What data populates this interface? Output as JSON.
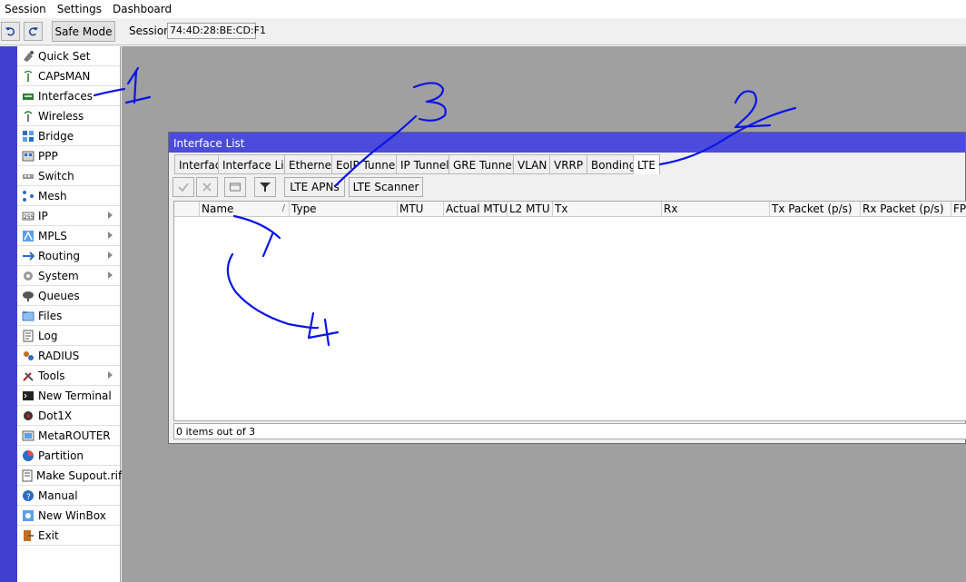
{
  "menu": [
    "Session",
    "Settings",
    "Dashboard"
  ],
  "toolbar": {
    "safe_mode_label": "Safe Mode",
    "session_label": "Session:",
    "session_value": "74:4D:28:BE:CD:F1"
  },
  "sidebar": {
    "items": [
      {
        "label": "Quick Set",
        "icon": "quick-set-icon",
        "submenu": false
      },
      {
        "label": "CAPsMAN",
        "icon": "capsman-icon",
        "submenu": false
      },
      {
        "label": "Interfaces",
        "icon": "interfaces-icon",
        "submenu": false
      },
      {
        "label": "Wireless",
        "icon": "wireless-icon",
        "submenu": false
      },
      {
        "label": "Bridge",
        "icon": "bridge-icon",
        "submenu": false
      },
      {
        "label": "PPP",
        "icon": "ppp-icon",
        "submenu": false
      },
      {
        "label": "Switch",
        "icon": "switch-icon",
        "submenu": false
      },
      {
        "label": "Mesh",
        "icon": "mesh-icon",
        "submenu": false
      },
      {
        "label": "IP",
        "icon": "ip-icon",
        "submenu": true
      },
      {
        "label": "MPLS",
        "icon": "mpls-icon",
        "submenu": true
      },
      {
        "label": "Routing",
        "icon": "routing-icon",
        "submenu": true
      },
      {
        "label": "System",
        "icon": "system-icon",
        "submenu": true
      },
      {
        "label": "Queues",
        "icon": "queues-icon",
        "submenu": false
      },
      {
        "label": "Files",
        "icon": "files-icon",
        "submenu": false
      },
      {
        "label": "Log",
        "icon": "log-icon",
        "submenu": false
      },
      {
        "label": "RADIUS",
        "icon": "radius-icon",
        "submenu": false
      },
      {
        "label": "Tools",
        "icon": "tools-icon",
        "submenu": true
      },
      {
        "label": "New Terminal",
        "icon": "terminal-icon",
        "submenu": false
      },
      {
        "label": "Dot1X",
        "icon": "dot1x-icon",
        "submenu": false
      },
      {
        "label": "MetaROUTER",
        "icon": "metarouter-icon",
        "submenu": false
      },
      {
        "label": "Partition",
        "icon": "partition-icon",
        "submenu": false
      },
      {
        "label": "Make Supout.rif",
        "icon": "supout-icon",
        "submenu": false
      },
      {
        "label": "Manual",
        "icon": "manual-icon",
        "submenu": false
      },
      {
        "label": "New WinBox",
        "icon": "winbox-icon",
        "submenu": false
      },
      {
        "label": "Exit",
        "icon": "exit-icon",
        "submenu": false
      }
    ]
  },
  "window": {
    "title": "Interface List",
    "tabs": [
      "Interface",
      "Interface List",
      "Ethernet",
      "EoIP Tunnel",
      "IP Tunnel",
      "GRE Tunnel",
      "VLAN",
      "VRRP",
      "Bonding",
      "LTE"
    ],
    "active_tab": "LTE",
    "buttons": {
      "lte_apns": "LTE APNs",
      "lte_scanner": "LTE Scanner"
    },
    "columns": [
      "Name",
      "Type",
      "MTU",
      "Actual MTU",
      "L2 MTU",
      "Tx",
      "Rx",
      "Tx Packet (p/s)",
      "Rx Packet (p/s)",
      "FP"
    ],
    "status": "0 items out of 3"
  },
  "annotations": [
    "1",
    "2",
    "3",
    "4"
  ],
  "colors": {
    "title_bar": "#4b4bdc",
    "accent_strip": "#3f3fd0",
    "ink": "#0a14e6"
  }
}
